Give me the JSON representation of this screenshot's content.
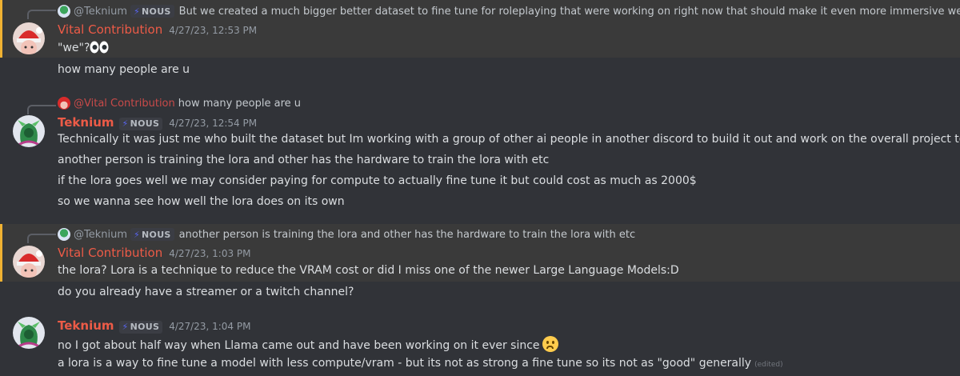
{
  "messages": [
    {
      "reply": {
        "mention": "@Teknium",
        "tag": "NOUS",
        "text": "But we created a much bigger better dataset to fine tune for roleplaying that were working on right now that should make it even more immersive we hope"
      },
      "author": "Vital Contribution",
      "time": "4/27/23, 12:53 PM",
      "lines": [
        "\"we\"?",
        "how many people are u"
      ]
    },
    {
      "reply": {
        "mention": "@Vital Contribution",
        "text": "how many people are u"
      },
      "author": "Teknium",
      "tag": "NOUS",
      "time": "4/27/23, 12:54 PM",
      "lines": [
        "Technically it was just me who built the dataset but Im working with a group of other ai people in another discord to build it out and work on the overall project together",
        "another person is training the lora and other has the hardware to train the lora with etc",
        "if the lora goes well we may consider paying for compute to actually fine tune it but could cost as much as 2000$",
        "so we wanna see how well the lora does on its own"
      ]
    },
    {
      "reply": {
        "mention": "@Teknium",
        "tag": "NOUS",
        "text": "another person is training the lora and other has the hardware to train the lora with etc"
      },
      "author": "Vital Contribution",
      "time": "4/27/23, 1:03 PM",
      "lines": [
        "the lora? Lora is a technique to reduce the VRAM cost or did I miss one of the newer Large Language Models:D",
        "do you already have a streamer or a twitch channel?"
      ]
    },
    {
      "author": "Teknium",
      "tag": "NOUS",
      "time": "4/27/23, 1:04 PM",
      "lines": [
        "no I got about half way when Llama came out and have been working on it ever since",
        "a lora is a way to fine tune a model with less compute/vram - but its not as strong a fine tune so its not as \"good\" generally"
      ],
      "edited": "(edited)"
    }
  ],
  "icons": {
    "bolt": "⚡"
  }
}
